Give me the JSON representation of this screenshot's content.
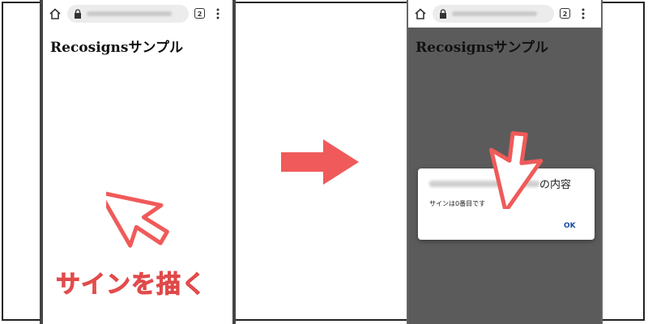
{
  "left_panel": {
    "page_title": "Recosignsサンプル",
    "tab_count": "2",
    "caption": "サインを描く"
  },
  "right_panel": {
    "page_title": "Recosignsサンプル",
    "tab_count": "2",
    "dialog": {
      "title_suffix": "の内容",
      "message": "サインは0番目です",
      "ok_label": "OK"
    }
  },
  "colors": {
    "accent_red": "#f05a5a",
    "overlay_gray": "#5b5b5b",
    "link_blue": "#1a4aa0"
  },
  "icons": [
    "home-icon",
    "lock-icon",
    "tab-switcher-icon",
    "kebab-menu-icon",
    "cursor-arrow-icon",
    "right-arrow-icon"
  ]
}
